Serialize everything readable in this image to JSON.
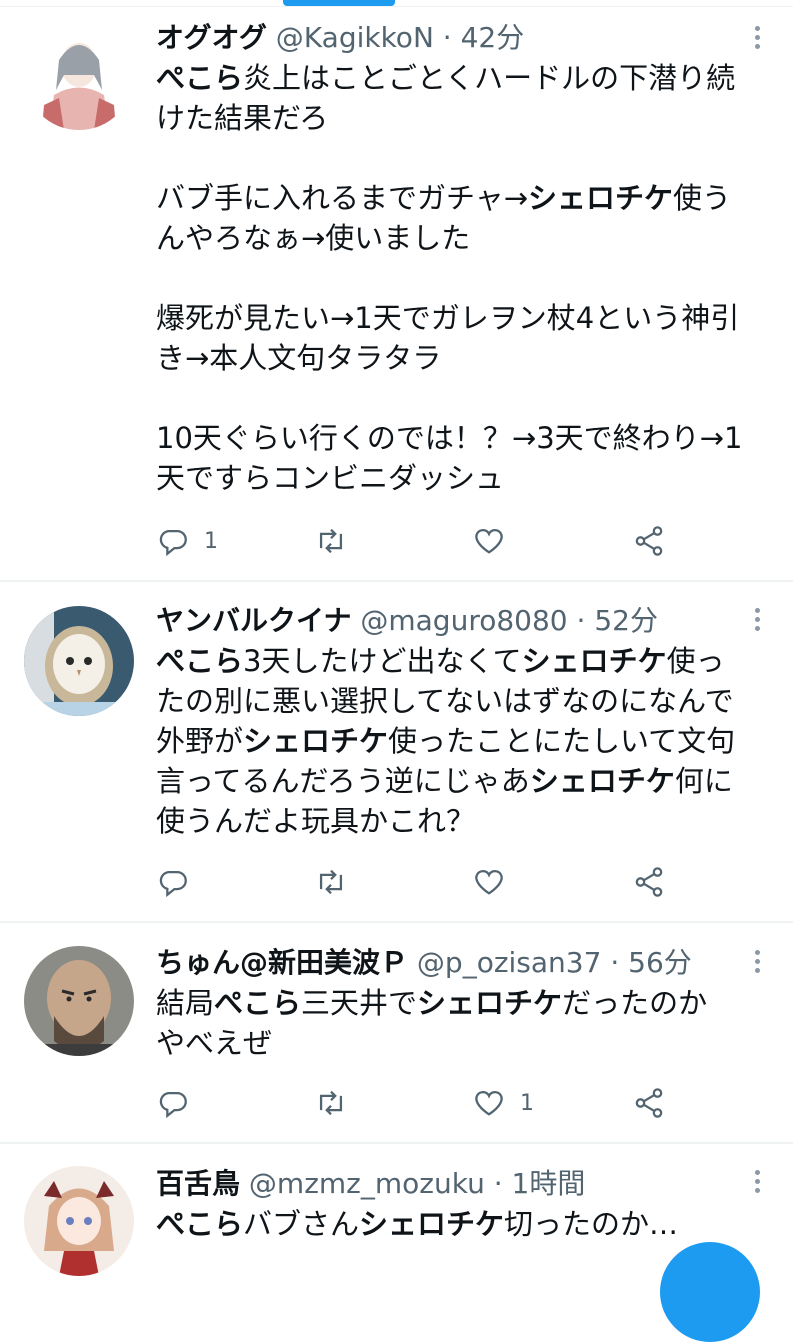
{
  "tweets": [
    {
      "name": "オグオグ",
      "handle": "@KagikkoN",
      "time": "· 42分",
      "lines": [
        [
          {
            "b": true,
            "t": "ぺこら"
          },
          {
            "t": "炎上はことごとくハードルの下潜り続"
          }
        ],
        [
          {
            "t": "けた結果だろ"
          }
        ],
        [
          {
            "t": ""
          }
        ],
        [
          {
            "t": "バブ手に入れるまでガチャ→"
          },
          {
            "b": true,
            "t": "シェロチケ"
          },
          {
            "t": "使う"
          }
        ],
        [
          {
            "t": "んやろなぁ→使いました"
          }
        ],
        [
          {
            "t": ""
          }
        ],
        [
          {
            "t": "爆死が見たい→1天でガレヲン杖4という神引"
          }
        ],
        [
          {
            "t": "き→本人文句タラタラ"
          }
        ],
        [
          {
            "t": ""
          }
        ],
        [
          {
            "t": "10天ぐらい行くのでは！？→3天で終わり→1"
          }
        ],
        [
          {
            "t": "天ですらコンビニダッシュ"
          }
        ]
      ],
      "reply_count": "1",
      "retweet_count": "",
      "like_count": ""
    },
    {
      "name": "ヤンバルクイナ",
      "handle": "@maguro8080",
      "time": "· 52分",
      "lines": [
        [
          {
            "b": true,
            "t": "ぺこら"
          },
          {
            "t": "3天したけど出なくて"
          },
          {
            "b": true,
            "t": "シェロチケ"
          },
          {
            "t": "使っ"
          }
        ],
        [
          {
            "t": "たの別に悪い選択してないはずなのになんで"
          }
        ],
        [
          {
            "t": "外野が"
          },
          {
            "b": true,
            "t": "シェロチケ"
          },
          {
            "t": "使ったことにたしいて文句"
          }
        ],
        [
          {
            "t": "言ってるんだろう逆にじゃあ"
          },
          {
            "b": true,
            "t": "シェロチケ"
          },
          {
            "t": "何に"
          }
        ],
        [
          {
            "t": "使うんだよ玩具かこれ？"
          }
        ]
      ],
      "reply_count": "",
      "retweet_count": "",
      "like_count": ""
    },
    {
      "name": "ちゅん@新田美波Ｐ",
      "handle": "@p_ozisan37",
      "time": "· 56分",
      "lines": [
        [
          {
            "t": "結局"
          },
          {
            "b": true,
            "t": "ぺこら"
          },
          {
            "t": "三天井で"
          },
          {
            "b": true,
            "t": "シェロチケ"
          },
          {
            "t": "だったのか"
          }
        ],
        [
          {
            "t": "やべえぜ"
          }
        ]
      ],
      "reply_count": "",
      "retweet_count": "",
      "like_count": "1"
    },
    {
      "name": "百舌鳥",
      "handle": "@mzmz_mozuku",
      "time": "· 1時間",
      "lines": [
        [
          {
            "b": true,
            "t": "ぺこら"
          },
          {
            "t": "バブさん"
          },
          {
            "b": true,
            "t": "シェロチケ"
          },
          {
            "t": "切ったのか…"
          }
        ]
      ],
      "reply_count": "",
      "retweet_count": "",
      "like_count": ""
    }
  ],
  "colors": {
    "accent": "#1d9bf0",
    "secondary_text": "#536471",
    "divider": "#eff3f4"
  },
  "icons": [
    "reply-icon",
    "retweet-icon",
    "like-icon",
    "share-icon",
    "more-icon",
    "compose-fab"
  ]
}
